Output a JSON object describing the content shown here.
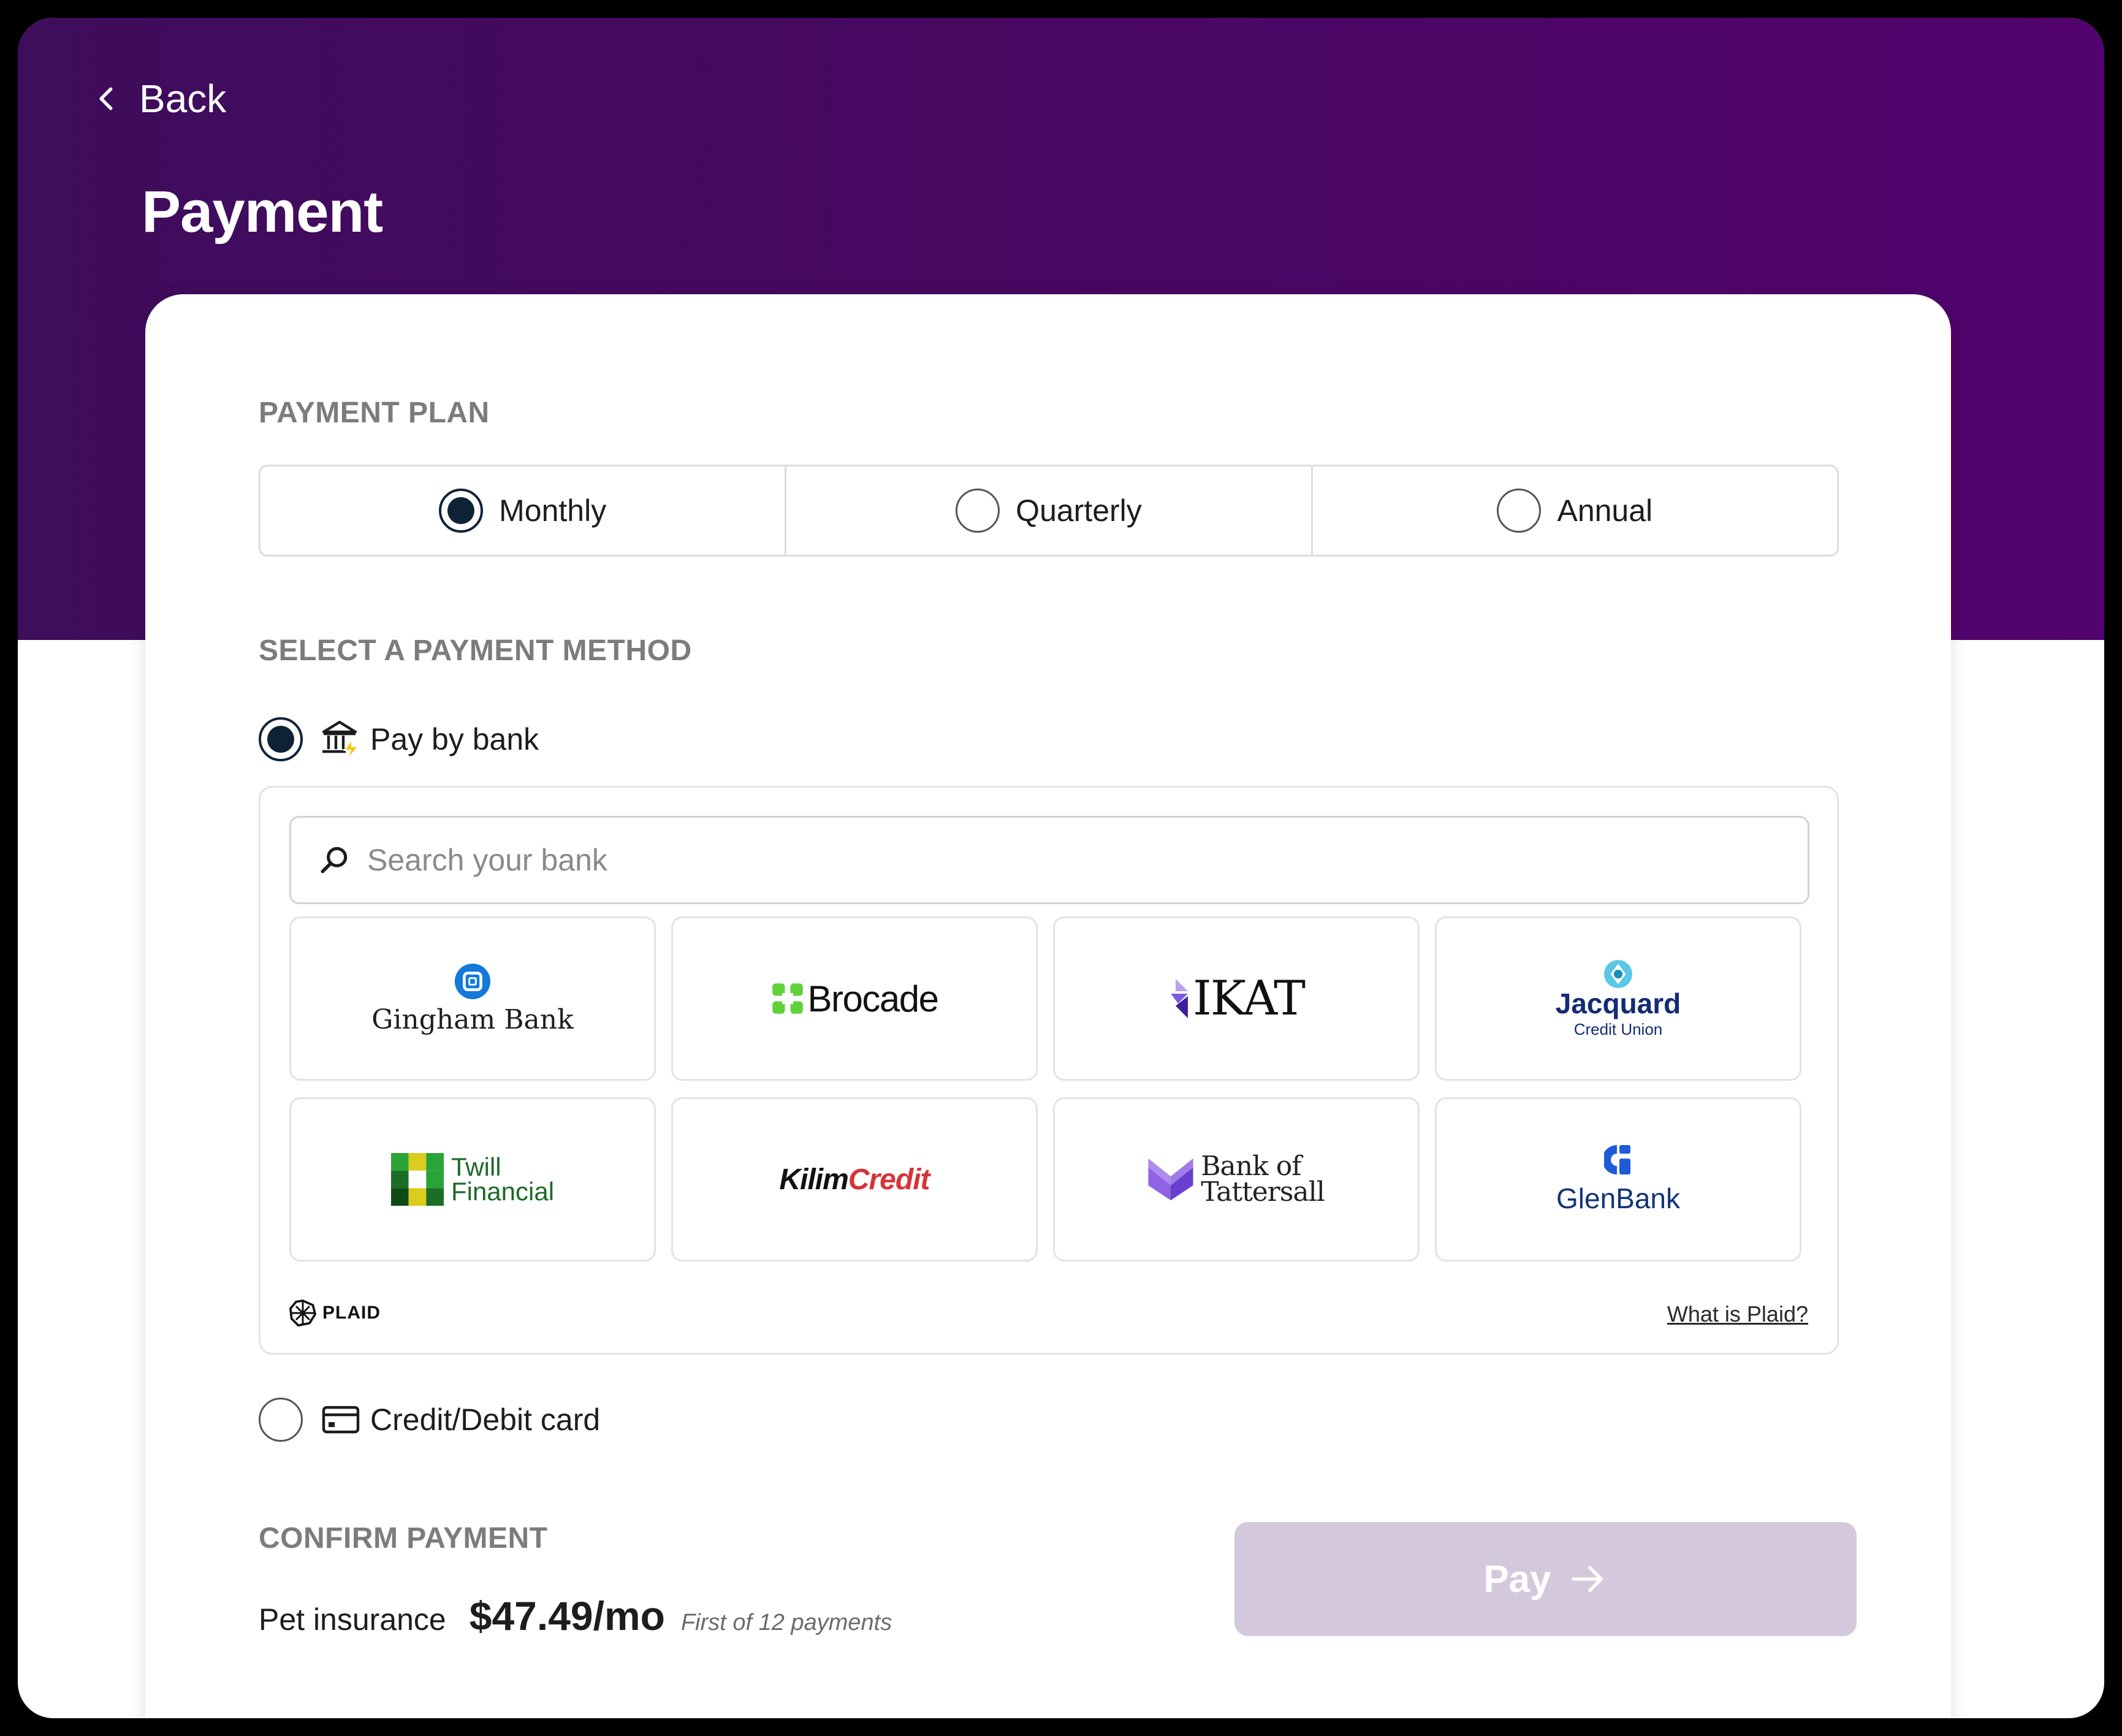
{
  "nav": {
    "back_label": "Back"
  },
  "page": {
    "title": "Payment"
  },
  "colors": {
    "hero_gradient_start": "#3e0d5c",
    "hero_gradient_end": "#52036d",
    "radio_checked": "#0e2236",
    "pay_button_disabled": "#d4c9dc",
    "section_label": "#7c7c7c"
  },
  "payment_plan": {
    "label": "PAYMENT PLAN",
    "options": [
      {
        "label": "Monthly",
        "selected": true
      },
      {
        "label": "Quarterly",
        "selected": false
      },
      {
        "label": "Annual",
        "selected": false
      }
    ]
  },
  "payment_method": {
    "label": "SELECT A PAYMENT METHOD",
    "pay_by_bank": {
      "label": "Pay by bank",
      "selected": true,
      "icon": "bank-lightning-icon"
    },
    "card": {
      "label": "Credit/Debit card",
      "selected": false,
      "icon": "credit-card-icon"
    },
    "search": {
      "placeholder": "Search your bank",
      "value": ""
    },
    "banks": [
      {
        "name": "Gingham Bank"
      },
      {
        "name": "Brocade"
      },
      {
        "name": "IKAT"
      },
      {
        "name": "Jacquard",
        "sub": "Credit Union"
      },
      {
        "name": "Twill",
        "sub": "Financial"
      },
      {
        "name": "Kilim",
        "sub": "Credit"
      },
      {
        "name": "Bank of",
        "sub": "Tattersall"
      },
      {
        "name": "GlenBank"
      }
    ],
    "provider": "PLAID",
    "provider_link": "What is Plaid?"
  },
  "confirm": {
    "label": "CONFIRM PAYMENT",
    "product": "Pet insurance",
    "price": "$47.49/mo",
    "note": "First of 12 payments",
    "pay_label": "Pay"
  }
}
